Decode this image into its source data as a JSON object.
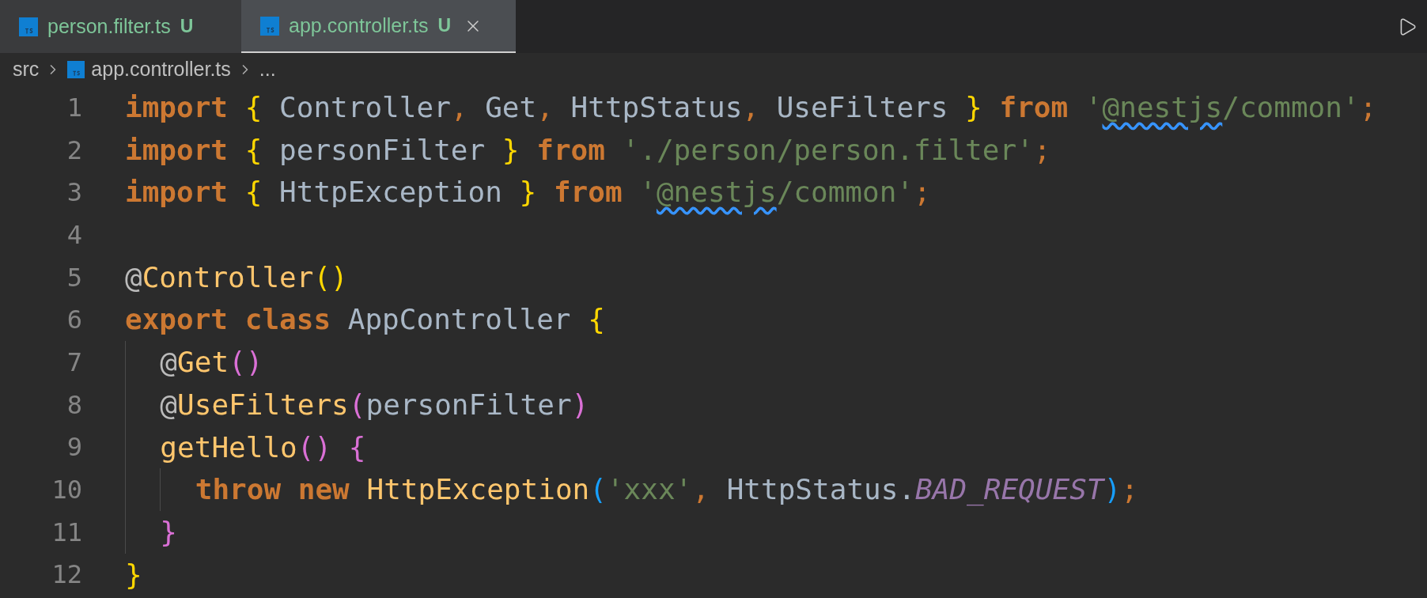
{
  "tabs": [
    {
      "label": "person.filter.ts",
      "status": "U",
      "selected": false
    },
    {
      "label": "app.controller.ts",
      "status": "U",
      "selected": true
    }
  ],
  "breadcrumbs": [
    "src",
    "app.controller.ts",
    "..."
  ],
  "editor": {
    "lines": [
      {
        "number": "1",
        "tokens": [
          {
            "kind": "keyword",
            "text": "import"
          },
          {
            "kind": "brace",
            "text": " {"
          },
          {
            "kind": "ident",
            "text": " Controller"
          },
          {
            "kind": "punct",
            "text": ","
          },
          {
            "kind": "ident",
            "text": " Get"
          },
          {
            "kind": "punct",
            "text": ","
          },
          {
            "kind": "ident",
            "text": " HttpStatus"
          },
          {
            "kind": "punct",
            "text": ","
          },
          {
            "kind": "ident",
            "text": " UseFilters "
          },
          {
            "kind": "brace",
            "text": "}"
          },
          {
            "kind": "keyword",
            "text": " from"
          },
          {
            "kind": "string",
            "text": " '"
          },
          {
            "kind": "string-warning",
            "text": "@nestjs"
          },
          {
            "kind": "string",
            "text": "/common'"
          },
          {
            "kind": "punct",
            "text": ";"
          }
        ]
      },
      {
        "number": "2",
        "tokens": [
          {
            "kind": "keyword",
            "text": "import"
          },
          {
            "kind": "brace",
            "text": " {"
          },
          {
            "kind": "ident",
            "text": " personFilter "
          },
          {
            "kind": "brace",
            "text": "}"
          },
          {
            "kind": "keyword",
            "text": " from"
          },
          {
            "kind": "string",
            "text": " './person/person.filter'"
          },
          {
            "kind": "punct",
            "text": ";"
          }
        ]
      },
      {
        "number": "3",
        "tokens": [
          {
            "kind": "keyword",
            "text": "import"
          },
          {
            "kind": "brace",
            "text": " {"
          },
          {
            "kind": "ident",
            "text": " HttpException "
          },
          {
            "kind": "brace",
            "text": "}"
          },
          {
            "kind": "keyword",
            "text": " from"
          },
          {
            "kind": "string",
            "text": " '"
          },
          {
            "kind": "string-warning",
            "text": "@nestjs"
          },
          {
            "kind": "string",
            "text": "/common'"
          },
          {
            "kind": "punct",
            "text": ";"
          }
        ]
      },
      {
        "number": "4"
      },
      {
        "number": "5",
        "tokens": [
          {
            "kind": "at",
            "text": "@"
          },
          {
            "kind": "decorator",
            "text": "Controller"
          },
          {
            "kind": "brace",
            "text": "()"
          }
        ]
      },
      {
        "number": "6",
        "tokens": [
          {
            "kind": "keyword",
            "text": "export class"
          },
          {
            "kind": "ident",
            "text": " AppController "
          },
          {
            "kind": "brace",
            "text": "{"
          }
        ]
      },
      {
        "number": "7",
        "tokens": [
          {
            "kind": "at",
            "text": "  @"
          },
          {
            "kind": "decorator",
            "text": "Get"
          },
          {
            "kind": "paren-pink",
            "text": "()"
          }
        ]
      },
      {
        "number": "8",
        "tokens": [
          {
            "kind": "at",
            "text": "  @"
          },
          {
            "kind": "decorator",
            "text": "UseFilters"
          },
          {
            "kind": "paren-pink",
            "text": "("
          },
          {
            "kind": "ident",
            "text": "personFilter"
          },
          {
            "kind": "paren-pink",
            "text": ")"
          }
        ]
      },
      {
        "number": "9",
        "tokens": [
          {
            "kind": "function",
            "text": "  getHello"
          },
          {
            "kind": "paren-pink",
            "text": "() {"
          }
        ]
      },
      {
        "number": "10",
        "tokens": [
          {
            "kind": "keyword",
            "text": "    throw new"
          },
          {
            "kind": "function",
            "text": " HttpException"
          },
          {
            "kind": "paren-blue",
            "text": "("
          },
          {
            "kind": "string",
            "text": "'xxx'"
          },
          {
            "kind": "punct",
            "text": ","
          },
          {
            "kind": "ident",
            "text": " HttpStatus."
          },
          {
            "kind": "constant",
            "text": "BAD_REQUEST"
          },
          {
            "kind": "paren-blue",
            "text": ")"
          },
          {
            "kind": "punct",
            "text": ";"
          }
        ]
      },
      {
        "number": "11",
        "tokens": [
          {
            "kind": "paren-pink",
            "text": "  }"
          }
        ]
      },
      {
        "number": "12",
        "tokens": [
          {
            "kind": "brace",
            "text": "}"
          }
        ]
      }
    ]
  }
}
